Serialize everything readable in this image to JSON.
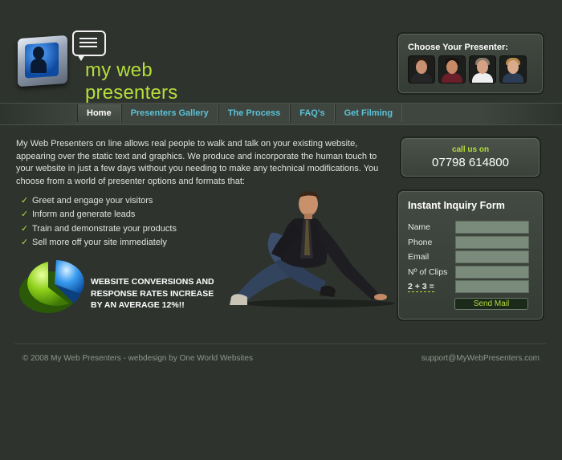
{
  "brand": {
    "logo_text": "my web presenters"
  },
  "chooser": {
    "title": "Choose Your Presenter:",
    "faces": [
      {
        "skin": "#c79172",
        "hair": "#2b1d14",
        "body": "#262626"
      },
      {
        "skin": "#c88a66",
        "hair": "#1a1212",
        "body": "#6a1f2a"
      },
      {
        "skin": "#d6a283",
        "hair": "#8c7a6a",
        "body": "#eeeeee"
      },
      {
        "skin": "#d9ab8c",
        "hair": "#b88a4a",
        "body": "#2c3e55"
      }
    ]
  },
  "nav": {
    "items": [
      "Home",
      "Presenters Gallery",
      "The Process",
      "FAQ's",
      "Get Filming"
    ],
    "active": "Home"
  },
  "intro": "My Web Presenters on line allows real people to walk and talk on your existing website, appearing over the static text and graphics. We produce and incorporate the human touch to your website in just a few days without you needing to make any technical modifications. You choose from a world of presenter options and formats that:",
  "bullets": [
    "Greet and engage your visitors",
    "Inform and generate leads",
    "Train and demonstrate your products",
    "Sell more off your site immediately"
  ],
  "stat": {
    "text": "WEBSITE CONVERSIONS AND RESPONSE RATES INCREASE BY AN AVERAGE 12%!!"
  },
  "call": {
    "label": "call us on",
    "number": "07798 614800"
  },
  "form": {
    "title": "Instant Inquiry Form",
    "fields": [
      {
        "label": "Name",
        "value": ""
      },
      {
        "label": "Phone",
        "value": ""
      },
      {
        "label": "Email",
        "value": ""
      },
      {
        "label": "Nº of Clips",
        "value": ""
      }
    ],
    "captcha": "2 + 3 =",
    "send_label": "Send Mail"
  },
  "footer": {
    "copyright": "© 2008 My Web Presenters - webdesign by One World Websites",
    "email": "support@MyWebPresenters.com"
  },
  "colors": {
    "accent": "#b5dd3c",
    "nav_link": "#5bc2d9",
    "background": "#2e332e"
  }
}
